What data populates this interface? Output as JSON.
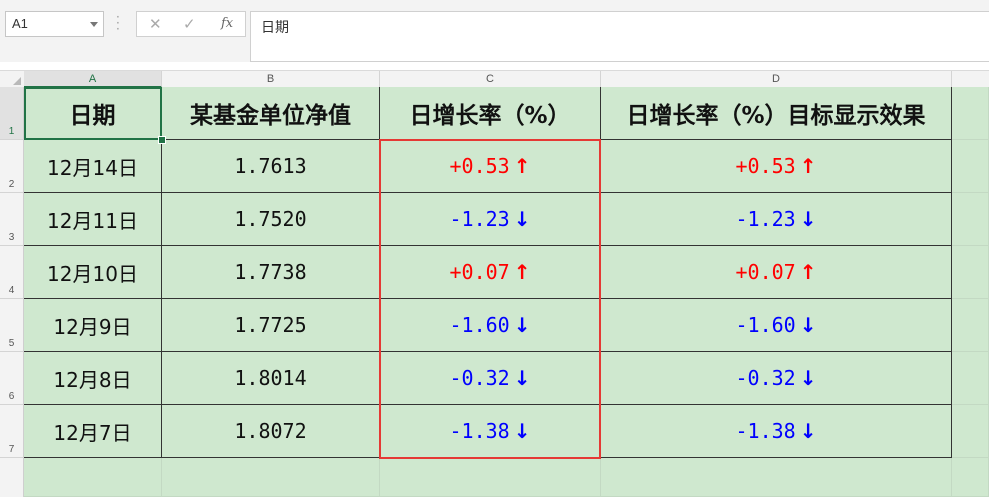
{
  "name_box": {
    "value": "A1"
  },
  "formula_bar": {
    "cancel_icon": "✕",
    "enter_icon": "✓",
    "fx_label": "fx",
    "content": "日期"
  },
  "columns": [
    "A",
    "B",
    "C",
    "D"
  ],
  "rows": [
    "1",
    "2",
    "3",
    "4",
    "5",
    "6",
    "7"
  ],
  "table": {
    "headers": [
      "日期",
      "某基金单位净值",
      "日增长率（%）",
      "日增长率（%）目标显示效果"
    ],
    "rows": [
      {
        "date": "12月14日",
        "nav": "1.7613",
        "growth": "+0.53",
        "growth_target": "+0.53",
        "direction": "up"
      },
      {
        "date": "12月11日",
        "nav": "1.7520",
        "growth": "-1.23",
        "growth_target": "-1.23",
        "direction": "down"
      },
      {
        "date": "12月10日",
        "nav": "1.7738",
        "growth": "+0.07",
        "growth_target": "+0.07",
        "direction": "up"
      },
      {
        "date": "12月9日",
        "nav": "1.7725",
        "growth": "-1.60",
        "growth_target": "-1.60",
        "direction": "down"
      },
      {
        "date": "12月8日",
        "nav": "1.8014",
        "growth": "-0.32",
        "growth_target": "-0.32",
        "direction": "down"
      },
      {
        "date": "12月7日",
        "nav": "1.8072",
        "growth": "-1.38",
        "growth_target": "-1.38",
        "direction": "down"
      }
    ]
  },
  "arrows": {
    "up": "↑",
    "down": "↓"
  },
  "colors": {
    "up": "#ff0000",
    "down": "#0000ff",
    "cell_fill": "#cfe8cf",
    "selection": "#217346",
    "highlight_border": "#e53935"
  }
}
